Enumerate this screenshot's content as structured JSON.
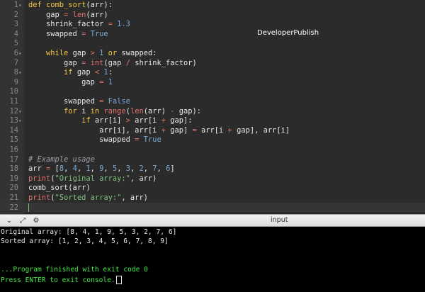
{
  "editor": {
    "watermark": "DeveloperPublish",
    "lines": [
      {
        "n": "1",
        "fold": "▾",
        "tokens": [
          {
            "t": "def ",
            "c": "kw"
          },
          {
            "t": "comb_sort",
            "c": "fn"
          },
          {
            "t": "(arr):",
            "c": "code"
          }
        ]
      },
      {
        "n": "2",
        "fold": "",
        "tokens": [
          {
            "t": "    gap ",
            "c": "code"
          },
          {
            "t": "=",
            "c": "op"
          },
          {
            "t": " ",
            "c": "code"
          },
          {
            "t": "len",
            "c": "bi"
          },
          {
            "t": "(arr)",
            "c": "code"
          }
        ]
      },
      {
        "n": "3",
        "fold": "",
        "tokens": [
          {
            "t": "    shrink_factor ",
            "c": "code"
          },
          {
            "t": "=",
            "c": "op"
          },
          {
            "t": " ",
            "c": "code"
          },
          {
            "t": "1.3",
            "c": "num"
          }
        ]
      },
      {
        "n": "4",
        "fold": "",
        "tokens": [
          {
            "t": "    swapped ",
            "c": "code"
          },
          {
            "t": "=",
            "c": "op"
          },
          {
            "t": " ",
            "c": "code"
          },
          {
            "t": "True",
            "c": "num"
          }
        ]
      },
      {
        "n": "5",
        "fold": "",
        "tokens": []
      },
      {
        "n": "6",
        "fold": "▾",
        "tokens": [
          {
            "t": "    ",
            "c": "code"
          },
          {
            "t": "while",
            "c": "kw"
          },
          {
            "t": " gap ",
            "c": "code"
          },
          {
            "t": ">",
            "c": "op"
          },
          {
            "t": " ",
            "c": "code"
          },
          {
            "t": "1",
            "c": "num"
          },
          {
            "t": " ",
            "c": "code"
          },
          {
            "t": "or",
            "c": "kw"
          },
          {
            "t": " swapped:",
            "c": "code"
          }
        ]
      },
      {
        "n": "7",
        "fold": "",
        "tokens": [
          {
            "t": "        gap ",
            "c": "code"
          },
          {
            "t": "=",
            "c": "op"
          },
          {
            "t": " ",
            "c": "code"
          },
          {
            "t": "int",
            "c": "bi"
          },
          {
            "t": "(gap ",
            "c": "code"
          },
          {
            "t": "/",
            "c": "op"
          },
          {
            "t": " shrink_factor)",
            "c": "code"
          }
        ]
      },
      {
        "n": "8",
        "fold": "▾",
        "tokens": [
          {
            "t": "        ",
            "c": "code"
          },
          {
            "t": "if",
            "c": "kw"
          },
          {
            "t": " gap ",
            "c": "code"
          },
          {
            "t": "<",
            "c": "op"
          },
          {
            "t": " ",
            "c": "code"
          },
          {
            "t": "1",
            "c": "num"
          },
          {
            "t": ":",
            "c": "code"
          }
        ]
      },
      {
        "n": "9",
        "fold": "",
        "tokens": [
          {
            "t": "            gap ",
            "c": "code"
          },
          {
            "t": "=",
            "c": "op"
          },
          {
            "t": " ",
            "c": "code"
          },
          {
            "t": "1",
            "c": "num"
          }
        ]
      },
      {
        "n": "10",
        "fold": "",
        "tokens": []
      },
      {
        "n": "11",
        "fold": "",
        "tokens": [
          {
            "t": "        swapped ",
            "c": "code"
          },
          {
            "t": "=",
            "c": "op"
          },
          {
            "t": " ",
            "c": "code"
          },
          {
            "t": "False",
            "c": "num"
          }
        ]
      },
      {
        "n": "12",
        "fold": "▾",
        "tokens": [
          {
            "t": "        ",
            "c": "code"
          },
          {
            "t": "for",
            "c": "kw"
          },
          {
            "t": " i ",
            "c": "code"
          },
          {
            "t": "in",
            "c": "kw"
          },
          {
            "t": " ",
            "c": "code"
          },
          {
            "t": "range",
            "c": "bi"
          },
          {
            "t": "(",
            "c": "code"
          },
          {
            "t": "len",
            "c": "bi"
          },
          {
            "t": "(arr) ",
            "c": "code"
          },
          {
            "t": "-",
            "c": "op"
          },
          {
            "t": " gap):",
            "c": "code"
          }
        ]
      },
      {
        "n": "13",
        "fold": "▾",
        "tokens": [
          {
            "t": "            ",
            "c": "code"
          },
          {
            "t": "if",
            "c": "kw"
          },
          {
            "t": " arr[i] ",
            "c": "code"
          },
          {
            "t": ">",
            "c": "op"
          },
          {
            "t": " arr[i ",
            "c": "code"
          },
          {
            "t": "+",
            "c": "op"
          },
          {
            "t": " gap]:",
            "c": "code"
          }
        ]
      },
      {
        "n": "14",
        "fold": "",
        "tokens": [
          {
            "t": "                arr[i], arr[i ",
            "c": "code"
          },
          {
            "t": "+",
            "c": "op"
          },
          {
            "t": " gap] ",
            "c": "code"
          },
          {
            "t": "=",
            "c": "op"
          },
          {
            "t": " arr[i ",
            "c": "code"
          },
          {
            "t": "+",
            "c": "op"
          },
          {
            "t": " gap], arr[i]",
            "c": "code"
          }
        ]
      },
      {
        "n": "15",
        "fold": "",
        "tokens": [
          {
            "t": "                swapped ",
            "c": "code"
          },
          {
            "t": "=",
            "c": "op"
          },
          {
            "t": " ",
            "c": "code"
          },
          {
            "t": "True",
            "c": "num"
          }
        ]
      },
      {
        "n": "16",
        "fold": "",
        "tokens": []
      },
      {
        "n": "17",
        "fold": "",
        "tokens": [
          {
            "t": "# Example usage",
            "c": "cmt"
          }
        ]
      },
      {
        "n": "18",
        "fold": "",
        "tokens": [
          {
            "t": "arr ",
            "c": "code"
          },
          {
            "t": "=",
            "c": "op"
          },
          {
            "t": " [",
            "c": "code"
          },
          {
            "t": "8",
            "c": "num"
          },
          {
            "t": ", ",
            "c": "code"
          },
          {
            "t": "4",
            "c": "num"
          },
          {
            "t": ", ",
            "c": "code"
          },
          {
            "t": "1",
            "c": "num"
          },
          {
            "t": ", ",
            "c": "code"
          },
          {
            "t": "9",
            "c": "num"
          },
          {
            "t": ", ",
            "c": "code"
          },
          {
            "t": "5",
            "c": "num"
          },
          {
            "t": ", ",
            "c": "code"
          },
          {
            "t": "3",
            "c": "num"
          },
          {
            "t": ", ",
            "c": "code"
          },
          {
            "t": "2",
            "c": "num"
          },
          {
            "t": ", ",
            "c": "code"
          },
          {
            "t": "7",
            "c": "num"
          },
          {
            "t": ", ",
            "c": "code"
          },
          {
            "t": "6",
            "c": "num"
          },
          {
            "t": "]",
            "c": "code"
          }
        ]
      },
      {
        "n": "19",
        "fold": "",
        "tokens": [
          {
            "t": "print",
            "c": "bi"
          },
          {
            "t": "(",
            "c": "code"
          },
          {
            "t": "\"Original array:\"",
            "c": "str"
          },
          {
            "t": ", arr)",
            "c": "code"
          }
        ]
      },
      {
        "n": "20",
        "fold": "",
        "tokens": [
          {
            "t": "comb_sort(arr)",
            "c": "code"
          }
        ]
      },
      {
        "n": "21",
        "fold": "",
        "tokens": [
          {
            "t": "print",
            "c": "bi"
          },
          {
            "t": "(",
            "c": "code"
          },
          {
            "t": "\"Sorted array:\"",
            "c": "str"
          },
          {
            "t": ", arr)",
            "c": "code"
          }
        ]
      },
      {
        "n": "22",
        "fold": "",
        "tokens": []
      }
    ]
  },
  "toolbar": {
    "label": "input",
    "icons": [
      "chevron-down-icon",
      "expand-icon",
      "settings-icon"
    ]
  },
  "console": {
    "lines": [
      {
        "text": "Original array: [8, 4, 1, 9, 5, 3, 2, 7, 6]",
        "color": "white"
      },
      {
        "text": "Sorted array: [1, 2, 3, 4, 5, 6, 7, 8, 9]",
        "color": "white"
      },
      {
        "text": "",
        "color": "white"
      },
      {
        "text": "",
        "color": "white"
      },
      {
        "text": "...Program finished with exit code 0",
        "color": "green"
      },
      {
        "text": "Press ENTER to exit console.",
        "color": "green"
      }
    ]
  },
  "colors": {
    "editor_bg": "#2b2b2b",
    "keyword": "#f2c744",
    "operator": "#e0726c",
    "number": "#7aaad6",
    "string": "#7ec27e",
    "console_green": "#45e645"
  }
}
